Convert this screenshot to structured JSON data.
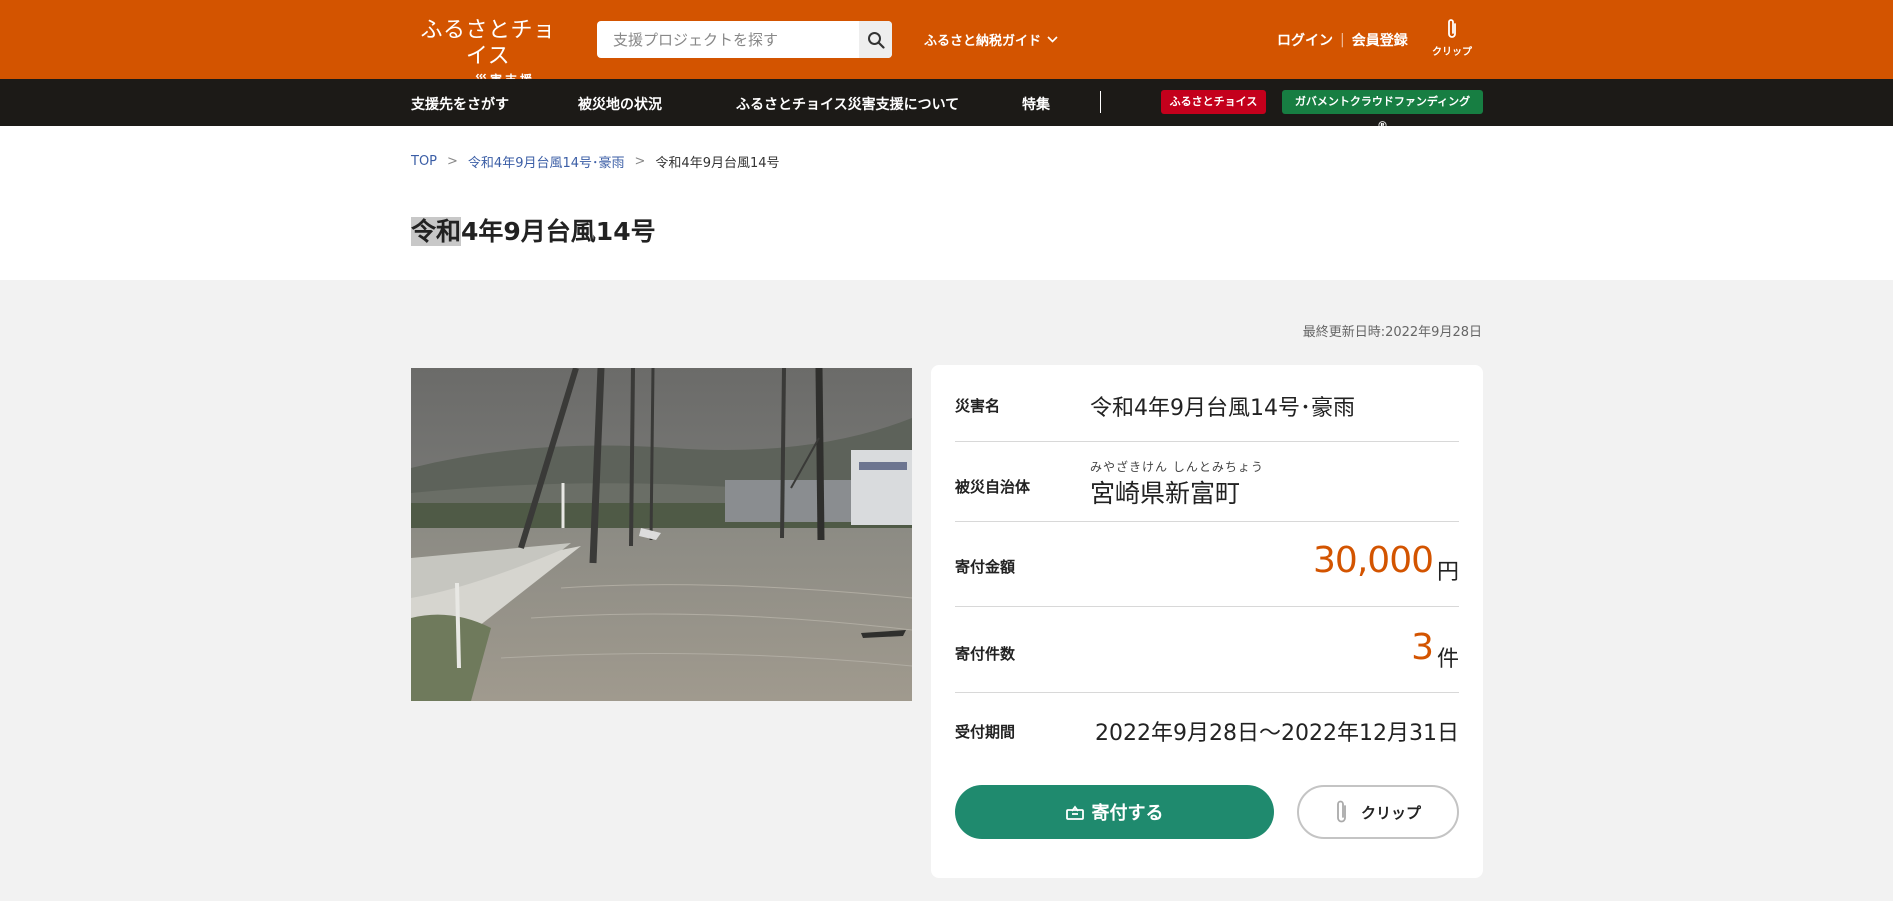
{
  "header": {
    "logo_main": "ふるさとチョイス",
    "logo_sub": "災害支援",
    "search_placeholder": "支援プロジェクトを探す",
    "guide_label": "ふるさと納税ガイド",
    "login_label": "ログイン",
    "register_label": "会員登録",
    "clip_label": "クリップ",
    "bg_color": "#d35400"
  },
  "nav": {
    "items": [
      "支援先をさがす",
      "被災地の状況",
      "ふるさとチョイス災害支援について",
      "特集"
    ],
    "badge_furusato": "ふるさとチョイス",
    "badge_gcf": "ガバメントクラウドファンディング®"
  },
  "breadcrumb": {
    "top": "TOP",
    "sep": ">",
    "parent": "令和4年9月台風14号･豪雨",
    "current": "令和4年9月台風14号"
  },
  "page": {
    "title_highlight": "令和",
    "title_rest": "4年9月台風14号",
    "updated": "最終更新日時:2022年9月28日"
  },
  "info": {
    "disaster_label": "災害名",
    "disaster_value": "令和4年9月台風14号･豪雨",
    "municipality_label": "被災自治体",
    "municipality_ruby": "みやざきけん しんとみちょう",
    "municipality_value": "宮崎県新富町",
    "amount_label": "寄付金額",
    "amount_value": "30,000",
    "amount_unit": "円",
    "count_label": "寄付件数",
    "count_value": "3",
    "count_unit": "件",
    "period_label": "受付期間",
    "period_value": "2022年9月28日～2022年12月31日",
    "accent_color": "#d35400"
  },
  "actions": {
    "donate_label": "寄付する",
    "clip_label": "クリップ",
    "donate_color": "#1f8a6e"
  }
}
